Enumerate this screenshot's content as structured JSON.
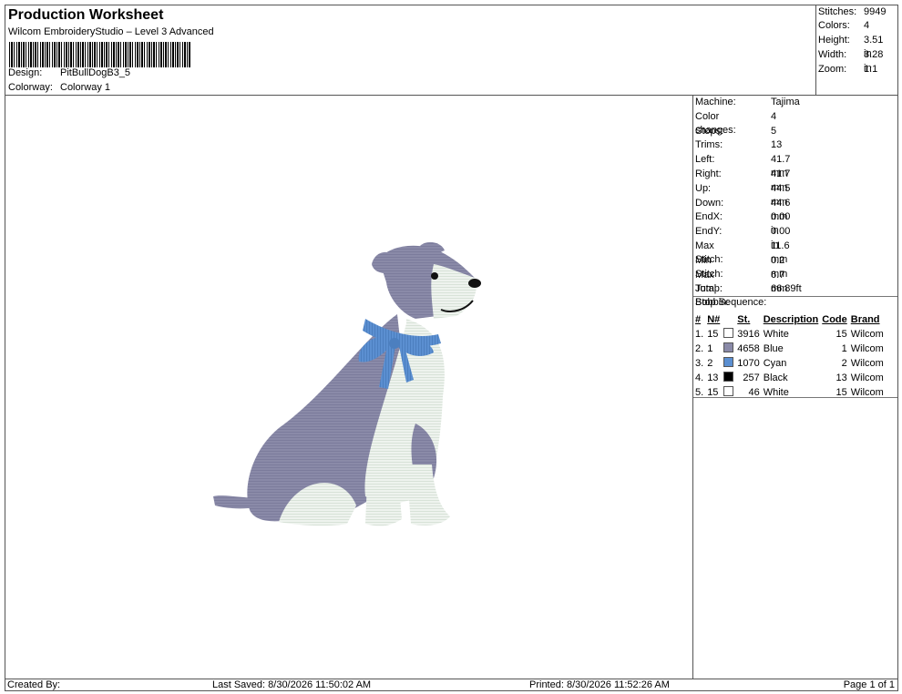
{
  "header": {
    "title": "Production Worksheet",
    "subtitle": "Wilcom EmbroideryStudio – Level 3 Advanced",
    "design_label": "Design:",
    "design_value": "PitBullDogB3_5",
    "colorway_label": "Colorway:",
    "colorway_value": "Colorway 1"
  },
  "stats": [
    {
      "label": "Stitches:",
      "value": "9949"
    },
    {
      "label": "Colors:",
      "value": "4"
    },
    {
      "label": "Height:",
      "value": "3.51 in"
    },
    {
      "label": "Width:",
      "value": "3.28 in"
    },
    {
      "label": "Zoom:",
      "value": "1:1"
    }
  ],
  "machine_info": [
    {
      "label": "Machine:",
      "value": "Tajima"
    },
    {
      "label": "Color changes:",
      "value": "4"
    },
    {
      "label": "Stops:",
      "value": "5"
    },
    {
      "label": "Trims:",
      "value": "13"
    },
    {
      "label": "Left:",
      "value": "41.7 mm"
    },
    {
      "label": "Right:",
      "value": "41.7 mm"
    },
    {
      "label": "Up:",
      "value": "44.5 mm"
    },
    {
      "label": "Down:",
      "value": "44.6 mm"
    },
    {
      "label": "EndX:",
      "value": "0.00 in"
    },
    {
      "label": "EndY:",
      "value": "0.00 in"
    },
    {
      "label": "Max Stitch:",
      "value": "11.6 mm"
    },
    {
      "label": "Min Stitch:",
      "value": "0.2 mm"
    },
    {
      "label": "Max Jump:",
      "value": "6.7 mm"
    },
    {
      "label": "Total Bobbin:",
      "value": "66.89ft"
    }
  ],
  "stop_sequence": {
    "title": "Stop Sequence:",
    "headers": [
      "#",
      "N#",
      "St.",
      "Description",
      "Code",
      "Brand"
    ],
    "rows": [
      {
        "idx": "1.",
        "n": "15",
        "color": "#ffffff",
        "st": "3916",
        "desc": "White",
        "code": "15",
        "brand": "Wilcom"
      },
      {
        "idx": "2.",
        "n": "1",
        "color": "#8a8aa8",
        "st": "4658",
        "desc": "Blue",
        "code": "1",
        "brand": "Wilcom"
      },
      {
        "idx": "3.",
        "n": "2",
        "color": "#5b8fd1",
        "st": "1070",
        "desc": "Cyan",
        "code": "2",
        "brand": "Wilcom"
      },
      {
        "idx": "4.",
        "n": "13",
        "color": "#000000",
        "st": "257",
        "desc": "Black",
        "code": "13",
        "brand": "Wilcom"
      },
      {
        "idx": "5.",
        "n": "15",
        "color": "#ffffff",
        "st": "46",
        "desc": "White",
        "code": "15",
        "brand": "Wilcom"
      }
    ]
  },
  "footer": {
    "created_by": "Created By:",
    "last_saved": "Last Saved: 8/30/2026 11:50:02 AM",
    "printed": "Printed: 8/30/2026 11:52:26 AM",
    "page": "Page 1 of 1"
  },
  "colors": {
    "body_grey": "#8a8aa8",
    "white_thread": "#eef3ee",
    "bow_blue": "#5b8fd1",
    "nose_black": "#111111"
  }
}
